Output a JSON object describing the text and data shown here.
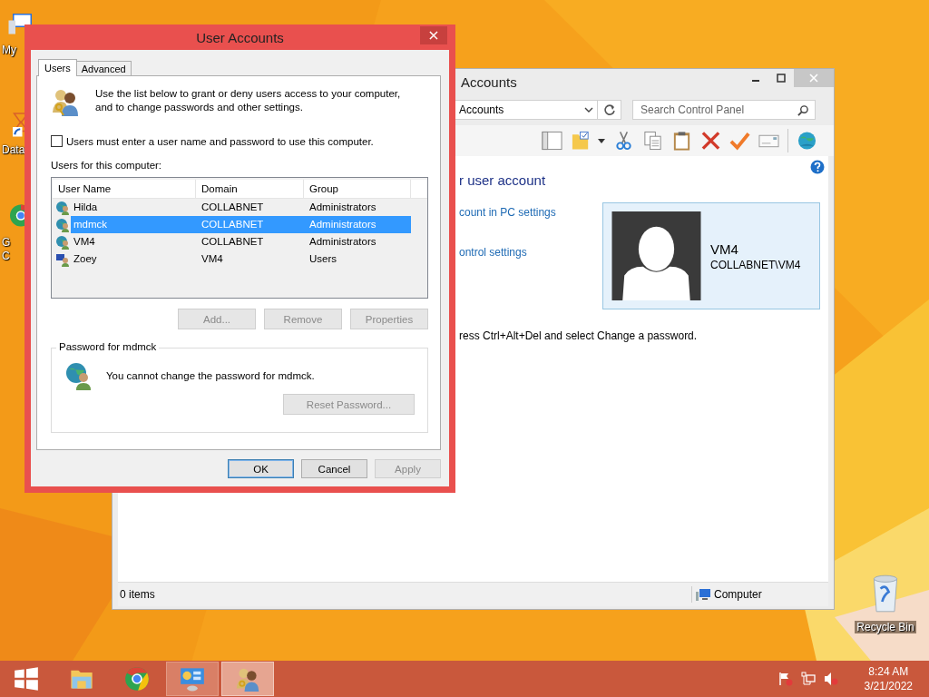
{
  "desktop": {
    "icons": [
      {
        "kind": "computer",
        "lines": [
          "My"
        ]
      },
      {
        "kind": "database",
        "lines": [
          "Data"
        ]
      },
      {
        "kind": "chrome",
        "lines": [
          "G",
          "C"
        ]
      }
    ],
    "recycle_bin": {
      "label": "Recycle Bin"
    }
  },
  "background_window": {
    "title": "Accounts",
    "address": "Accounts",
    "search": {
      "placeholder": "Search Control Panel"
    },
    "heading": "r user account",
    "links": [
      "count in PC settings",
      "ontrol settings"
    ],
    "note": "ress Ctrl+Alt+Del and select Change a password.",
    "account": {
      "name": "VM4",
      "domain": "COLLABNET\\VM4"
    },
    "status_bar": {
      "count": "0 items",
      "zone": "Computer"
    }
  },
  "dialog": {
    "title": "User Accounts",
    "close": "×",
    "tabs": [
      {
        "label": "Users",
        "selected": true
      },
      {
        "label": "Advanced",
        "selected": false
      }
    ],
    "intro": "Use the list below to grant or deny users access to your computer, and to change passwords and other settings.",
    "require_login": {
      "label": "Users must enter a user name and password to use this computer.",
      "checked": false
    },
    "list_label": "Users for this computer:",
    "columns": [
      "User Name",
      "Domain",
      "Group"
    ],
    "rows": [
      {
        "kind": "domain",
        "user": "Hilda",
        "domain": "COLLABNET",
        "group": "Administrators",
        "selected": false
      },
      {
        "kind": "domain",
        "user": "mdmck",
        "domain": "COLLABNET",
        "group": "Administrators",
        "selected": true
      },
      {
        "kind": "domain",
        "user": "VM4",
        "domain": "COLLABNET",
        "group": "Administrators",
        "selected": false
      },
      {
        "kind": "local",
        "user": "Zoey",
        "domain": "VM4",
        "group": "Users",
        "selected": false
      }
    ],
    "list_buttons": [
      {
        "label": "Add...",
        "disabled": true
      },
      {
        "label": "Remove",
        "disabled": true
      },
      {
        "label": "Properties",
        "disabled": true
      }
    ],
    "password_group": {
      "title": "Password for mdmck",
      "message": "You cannot change the password for mdmck.",
      "button": {
        "label": "Reset Password...",
        "disabled": true
      }
    },
    "footer_buttons": [
      {
        "label": "OK",
        "disabled": false,
        "default": true
      },
      {
        "label": "Cancel",
        "disabled": false,
        "default": false
      },
      {
        "label": "Apply",
        "disabled": true,
        "default": false
      }
    ]
  },
  "taskbar": {
    "items": [
      {
        "kind": "start",
        "open": false,
        "selected": false
      },
      {
        "kind": "explorer",
        "open": false,
        "selected": false
      },
      {
        "kind": "chrome",
        "open": false,
        "selected": false
      },
      {
        "kind": "control-panel",
        "open": true,
        "selected": false
      },
      {
        "kind": "users",
        "open": true,
        "selected": true
      }
    ],
    "time": "8:24 AM",
    "date": "3/21/2022"
  }
}
